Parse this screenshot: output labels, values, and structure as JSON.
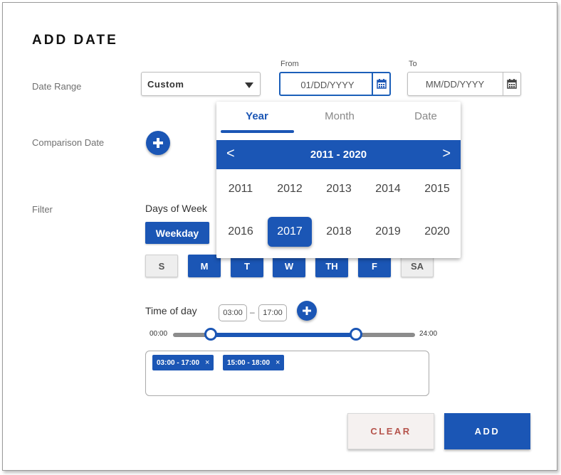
{
  "title": "ADD DATE",
  "date_range": {
    "label": "Date Range",
    "select_value": "Custom",
    "from_label": "From",
    "from_value": "01/DD/YYYY",
    "to_label": "To",
    "to_value": "MM/DD/YYYY"
  },
  "comparison": {
    "label": "Comparison Date"
  },
  "filter": {
    "label": "Filter",
    "days_label": "Days of Week",
    "weekday_button": "Weekday",
    "days": [
      {
        "label": "S",
        "selected": false
      },
      {
        "label": "M",
        "selected": true
      },
      {
        "label": "T",
        "selected": true
      },
      {
        "label": "W",
        "selected": true
      },
      {
        "label": "TH",
        "selected": true
      },
      {
        "label": "F",
        "selected": true
      },
      {
        "label": "SA",
        "selected": false
      }
    ],
    "time_label": "Time of day",
    "time_start": "03:00",
    "time_sep": "–",
    "time_end": "17:00",
    "slider_min": "00:00",
    "slider_max": "24:00",
    "slider_low": 0.155,
    "slider_high": 0.755,
    "chips": [
      "03:00 - 17:00",
      "15:00 - 18:00"
    ],
    "chip_remove": "×"
  },
  "picker": {
    "tabs": [
      "Year",
      "Month",
      "Date"
    ],
    "active_tab": "Year",
    "range": "2011 - 2020",
    "prev": "<",
    "next": ">",
    "years": [
      "2011",
      "2012",
      "2013",
      "2014",
      "2015",
      "2016",
      "2017",
      "2018",
      "2019",
      "2020"
    ],
    "selected_year": "2017"
  },
  "buttons": {
    "clear": "CLEAR",
    "add": "ADD"
  },
  "colors": {
    "accent": "#1b56b5",
    "clear_text": "#b5534b"
  }
}
